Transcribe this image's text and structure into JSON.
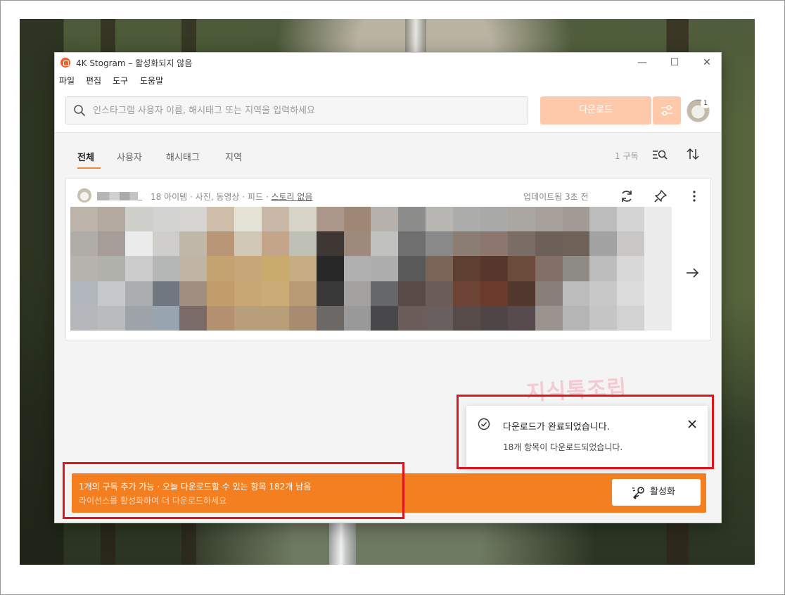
{
  "window": {
    "title": "4K Stogram – 활성화되지 않음",
    "controls": {
      "minimize": "—",
      "maximize": "☐",
      "close": "✕"
    }
  },
  "menu": {
    "items": [
      "파일",
      "편집",
      "도구",
      "도움말"
    ]
  },
  "toolbar": {
    "search_placeholder": "인스타그램 사용자 이름, 해시태그 또는 지역을 입력하세요",
    "download_label": "다운로드",
    "avatar_badge": "1"
  },
  "tabs": {
    "items": [
      "전체",
      "사용자",
      "해시태그",
      "지역"
    ],
    "active": "전체",
    "subscription_count": "1 구독"
  },
  "card": {
    "username_suffix": "_",
    "meta": "18 아이템 · 사진, 동영상 · 피드 · ",
    "story": "스토리 없음",
    "updated": "업데이트됨 3초 전"
  },
  "toast": {
    "title": "다운로드가 완료되었습니다.",
    "body": "18개 항목이 다운로드되었습니다."
  },
  "watermark": "지식톡조립",
  "license": {
    "line1": "1개의 구독 추가 가능 · 오늘 다운로드할 수 있는 항목 182개 남음",
    "line2": "라이선스를 활성화하여 더 다운로드하세요",
    "activate_label": "활성화"
  },
  "colors": {
    "accent": "#f47f20",
    "download_disabled": "#fdc9aa",
    "annotation_red": "#e0141b"
  },
  "mosaic_colors": [
    "#bcb3ab",
    "#b5aaa2",
    "#cfcfcb",
    "#d3d4d1",
    "#d6d5d1",
    "#cfbdab",
    "#e5e2d6",
    "#c9b7a7",
    "#d7d5c9",
    "#ab978a",
    "#9f8777",
    "#b5b2ae",
    "#8d8d8b",
    "#b7b6b3",
    "#acacaa",
    "#a9a9a7",
    "#aaa7a3",
    "#a7a09b",
    "#a29a95",
    "#bcbcbc",
    "#d4d4d4",
    "#ececec",
    "#b0aca7",
    "#a69c98",
    "#ebebeb",
    "#cfcecb",
    "#c2b8aa",
    "#b89676",
    "#d1c8b8",
    "#c3a68a",
    "#bfc0b6",
    "#3f3733",
    "#9e8a7d",
    "#c1c1c0",
    "#6f6f6f",
    "#898989",
    "#8c7d74",
    "#8c766d",
    "#7a6d65",
    "#6d6058",
    "#706258",
    "#a3a3a3",
    "#c9c7c5",
    "#ececec",
    "#b5b3ae",
    "#b1b1ab",
    "#cacbca",
    "#b4b6b5",
    "#c0b4a5",
    "#c5a371",
    "#c7a779",
    "#caac6f",
    "#c7ad83",
    "#282828",
    "#b0b0b0",
    "#aeaeae",
    "#595959",
    "#7b6558",
    "#5f3f31",
    "#56382c",
    "#6c4c3d",
    "#826f66",
    "#8e8b87",
    "#bdbdbd",
    "#d8d8d8",
    "#ececec",
    "#b2b6bd",
    "#c6c9cb",
    "#abaeb1",
    "#707780",
    "#a08f80",
    "#c29c6b",
    "#c9a774",
    "#ccac76",
    "#b89a74",
    "#393939",
    "#a4a2a0",
    "#666769",
    "#584b47",
    "#6b5c58",
    "#6c4335",
    "#6c3a2c",
    "#52372e",
    "#8a7e78",
    "#bcbcbc",
    "#c8c8c8",
    "#dcdcdc",
    "#ececec",
    "#b5b7bb",
    "#b9bbbd",
    "#9ea4a9",
    "#98a4b0",
    "#7b6b66",
    "#b59070",
    "#b89e7a",
    "#b89e79",
    "#a98c70",
    "#6b6866",
    "#99999a",
    "#48484b",
    "#6b5e5a",
    "#695f5f",
    "#574b4a",
    "#4f4546",
    "#574b4d",
    "#9a938e",
    "#b5b5b5",
    "#c5c5c5",
    "#d2d2d2",
    "#ececec"
  ]
}
